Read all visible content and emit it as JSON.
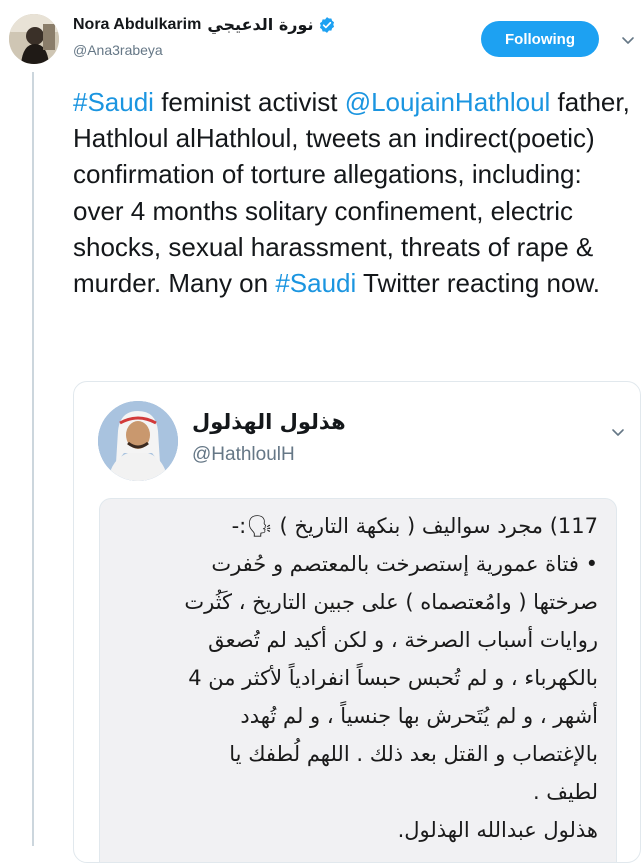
{
  "author": {
    "display_name": "Nora Abdulkarim",
    "arabic_name": "نورة الدعيجي",
    "handle": "@Ana3rabeya",
    "verified": true
  },
  "follow_button": {
    "label": "Following",
    "color": "#1da1f2"
  },
  "tweet": {
    "segments": [
      {
        "text": "#Saudi",
        "link": true
      },
      {
        "text": " feminist activist ",
        "link": false
      },
      {
        "text": "@LoujainHathloul",
        "link": true
      },
      {
        "text": " father, Hathloul alHathloul, tweets an indirect(poetic) confirmation of torture allegations, including: over 4 months solitary confinement, electric shocks, sexual harassment, threats of rape & murder. Many on ",
        "link": false
      },
      {
        "text": "#Saudi",
        "link": true
      },
      {
        "text": " Twitter reacting now.",
        "link": false
      }
    ]
  },
  "quoted_tweet": {
    "display_name": "هذلول الهذلول",
    "handle": "@HathloulH",
    "image_text_lines": [
      "117) مجرد سواليف ( بنكهة التاريخ ) 🗣:-",
      "• فتاة عمورية  إستصرخت بالمعتصم و حُفرت",
      "صرختها ( وامُعتصماه ) على جبين التاريخ  ، كَثُرت",
      "روايات أسباب الصرخة ، و  لكن أكيد لم تُصعق",
      "بالكهرباء ، و لم تُحبس حبساً انفرادياً لأكثر من 4",
      "أشهر  ، و لم يُتَحرش بها جنسياً ، و لم تُهدد",
      "بالإغتصاب و القتل بعد ذلك . اللهم لُطفك يا",
      "لطيف .",
      "هذلول عبدالله الهذلول."
    ]
  },
  "icons": {
    "verified": "verified-badge-icon",
    "caret": "chevron-down-icon"
  },
  "colors": {
    "link": "#1b95e0",
    "thread_line": "#ccd6dd",
    "secondary_text": "#657786"
  }
}
